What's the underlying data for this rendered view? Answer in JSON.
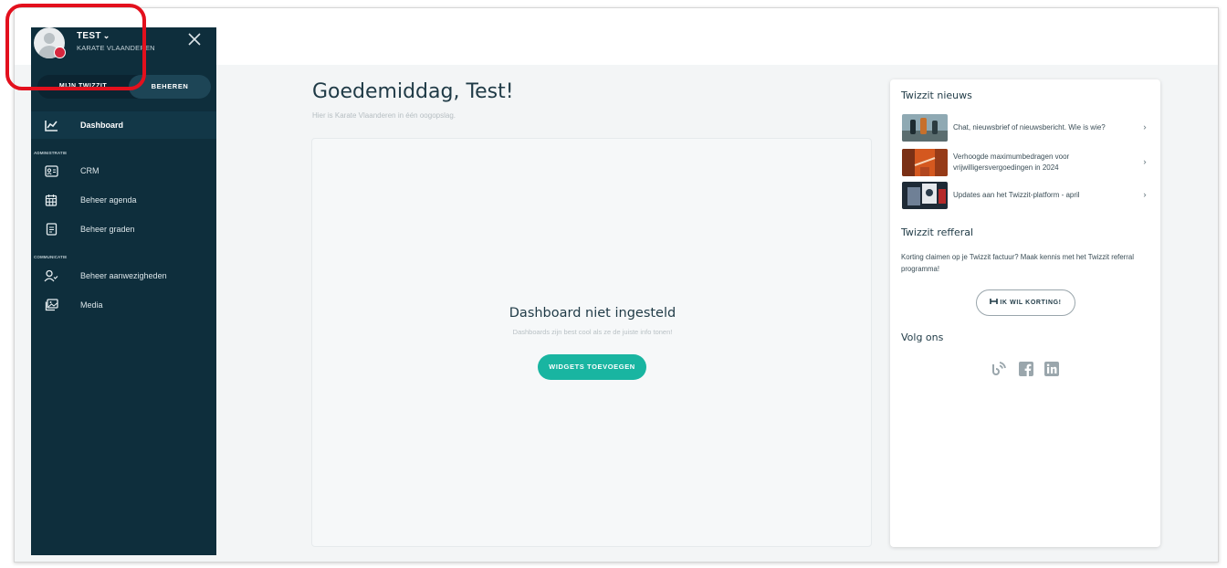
{
  "user": {
    "name": "TEST",
    "org": "KARATE VLAANDEREN"
  },
  "tabs": {
    "left": "MIJN TWIZZIT",
    "right": "BEHEREN"
  },
  "sidebar": {
    "items": [
      {
        "label": "Dashboard",
        "icon": "chart-line-icon"
      },
      {
        "label": "CRM",
        "icon": "contact-card-icon"
      },
      {
        "label": "Beheer agenda",
        "icon": "calendar-icon"
      },
      {
        "label": "Beheer graden",
        "icon": "document-icon"
      },
      {
        "label": "Beheer aanwezigheden",
        "icon": "user-check-icon"
      },
      {
        "label": "Media",
        "icon": "photos-icon"
      }
    ],
    "sections": {
      "admin": "ADMINISTRATIE",
      "comm": "COMMUNICATIE"
    }
  },
  "main": {
    "greeting": "Goedemiddag, Test!",
    "subtitle": "Hier is Karate Vlaanderen in één oogopslag.",
    "dashboard_title": "Dashboard niet ingesteld",
    "dashboard_sub": "Dashboards zijn best cool als ze de juiste info tonen!",
    "widgets_button": "WIDGETS TOEVOEGEN"
  },
  "right": {
    "news_heading": "Twizzit nieuws",
    "news": [
      {
        "text": "Chat, nieuwsbrief of nieuwsbericht. Wie is wie?"
      },
      {
        "text": "Verhoogde maximumbedragen voor vrijwilligersvergoedingen in 2024"
      },
      {
        "text": "Updates aan het Twizzit-platform - april"
      }
    ],
    "referral_heading": "Twizzit refferal",
    "referral_text": "Korting claimen op je Twizzit factuur? Maak kennis met het Twizzit referral programma!",
    "korting_button": "IK WIL KORTING!",
    "follow_heading": "Volg ons"
  },
  "colors": {
    "sidebar": "#0e2e3c",
    "accent": "#19b5a1",
    "highlight": "#e3101d"
  }
}
